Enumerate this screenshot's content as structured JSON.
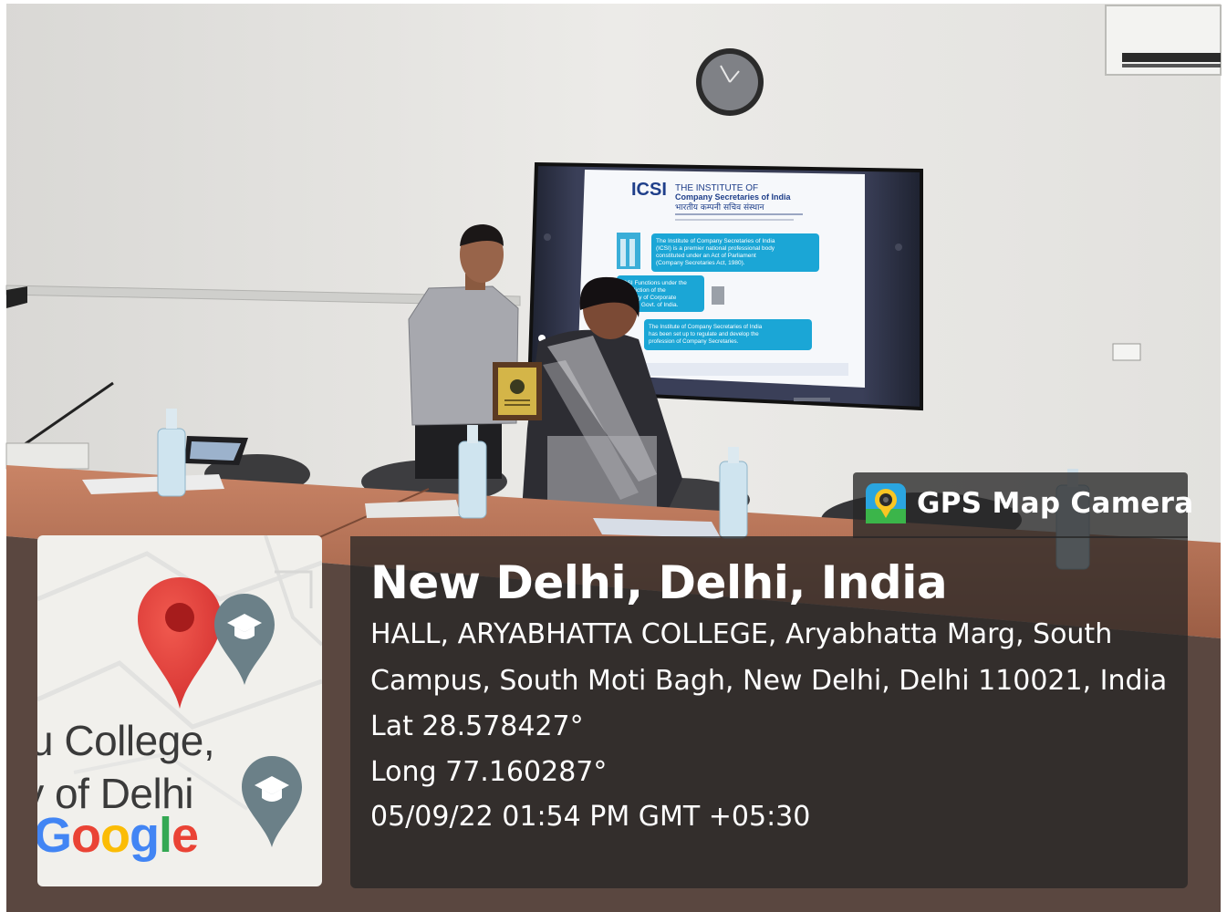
{
  "colors": {
    "wall": "#e6e5e2",
    "desk": "#b87456",
    "panel_overlay": "#262626",
    "map_pin": "#e53935",
    "map_poi": "#607d8b",
    "google_blue": "#4285f4",
    "google_red": "#ea4335",
    "google_yellow": "#fbbc05",
    "google_green": "#34a853"
  },
  "badge": {
    "icon": "gps-map-camera-icon",
    "title": "GPS Map Camera"
  },
  "location": {
    "title": "New Delhi, Delhi, India",
    "address_line1": "HALL, ARYABHATTA COLLEGE, Aryabhatta Marg, South",
    "address_line2": "Campus, South Moti Bagh, New Delhi, Delhi 110021, India",
    "latitude": "Lat 28.578427°",
    "longitude": "Long 77.160287°",
    "datetime": "05/09/22 01:54 PM GMT +05:30"
  },
  "map": {
    "label_line1": "u College,",
    "label_line2": "ty of Delhi",
    "logo_letters": [
      "G",
      "o",
      "o",
      "g",
      "l",
      "e"
    ],
    "pin_icon": "location-pin-icon",
    "poi_icon": "graduation-cap-icon"
  },
  "screen": {
    "logo": "ICSI",
    "heading_line1": "THE INSTITUTE OF",
    "heading_line2": "Company Secretaries of India",
    "hindi_line": "भारतीय कम्पनी सचिव संस्थान",
    "box1_line1": "The Institute of Company Secretaries of India",
    "box1_line2": "(ICSI) is a premier national professional body",
    "box1_line3": "constituted under an Act of Parliament",
    "box1_line4": "(Company Secretaries Act, 1980).",
    "box2_line1": "ICSI Functions under the",
    "box2_line2": "jurisdiction of the",
    "box2_line3": "Ministry of Corporate",
    "box2_line4": "Affairs, Govt. of India.",
    "box3_line1": "The Institute of Company Secretaries of India",
    "box3_line2": "has been set up to regulate and develop the",
    "box3_line3": "profession of Company Secretaries."
  }
}
